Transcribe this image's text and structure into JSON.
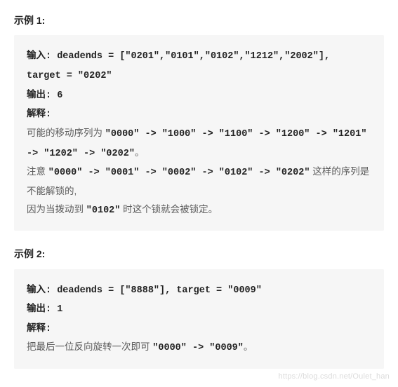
{
  "example1": {
    "header": "示例 1:",
    "input_line1": "输入: deadends = [\"0201\",\"0101\",\"0102\",\"1212\",\"2002\"],",
    "input_line2": "target = \"0202\"",
    "output_line": "输出: 6",
    "explain_label": "解释:",
    "seq_intro": "可能的移动序列为 ",
    "seq_chain": "\"0000\" -> \"1000\" -> \"1100\" -> \"1200\" -> \"1201\" -> \"1202\" -> \"0202\"",
    "seq_period": "。",
    "note_prefix": "注意 ",
    "note_chain": "\"0000\" -> \"0001\" -> \"0002\" -> \"0102\" -> \"0202\"",
    "note_suffix": " 这样的序列是不能解锁的,",
    "reason_prefix": "因为当拨动到 ",
    "reason_code": "\"0102\"",
    "reason_suffix": " 时这个锁就会被锁定。"
  },
  "example2": {
    "header": "示例 2:",
    "input_line": "输入: deadends = [\"8888\"], target = \"0009\"",
    "output_line": "输出: 1",
    "explain_label": "解释:",
    "explain_text": "把最后一位反向旋转一次即可 ",
    "explain_chain": "\"0000\" -> \"0009\"",
    "explain_period": "。"
  },
  "watermark": "https://blog.csdn.net/Oulet_han"
}
